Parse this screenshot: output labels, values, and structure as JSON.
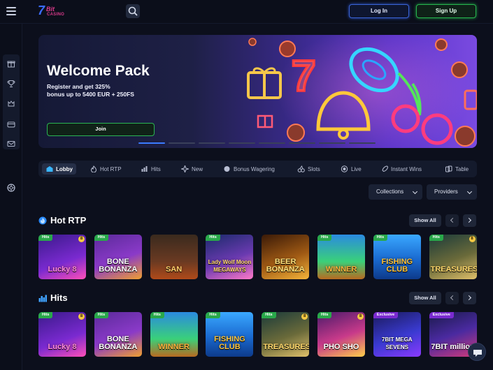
{
  "header": {
    "logo": {
      "big": "7",
      "bit": "Bit",
      "casino": "CASINO"
    },
    "login_label": "Log In",
    "signup_label": "Sign Up"
  },
  "hero": {
    "title": "Welcome Pack",
    "subtitle_line1": "Register and get 325%",
    "subtitle_line2": "bonus up to 5400 EUR + 250FS",
    "join_label": "Join",
    "slides": 8,
    "active_slide": 1
  },
  "categories": [
    {
      "label": "Lobby",
      "icon": "lobby-icon",
      "active": true
    },
    {
      "label": "Hot RTP",
      "icon": "fire-icon",
      "active": false
    },
    {
      "label": "Hits",
      "icon": "bars-icon",
      "active": false
    },
    {
      "label": "New",
      "icon": "sparkle-icon",
      "active": false
    },
    {
      "label": "Bonus Wagering",
      "icon": "coin-icon",
      "active": false
    },
    {
      "label": "Slots",
      "icon": "cherries-icon",
      "active": false
    },
    {
      "label": "Live",
      "icon": "live-icon",
      "active": false
    },
    {
      "label": "Instant Wins",
      "icon": "rocket-icon",
      "active": false
    },
    {
      "label": "Table",
      "icon": "cards-icon",
      "active": false
    }
  ],
  "filters": {
    "collections_label": "Collections",
    "providers_label": "Providers"
  },
  "sections": [
    {
      "title": "Hot RTP",
      "icon": "hot-rtp-icon",
      "show_all_label": "Show All",
      "tiles": [
        {
          "name": "Lucky 8",
          "badge": "Hits",
          "emblem": "8",
          "name_color": "#ff8ad8"
        },
        {
          "name": "BONE BONANZA",
          "badge": "Hits",
          "emblem": "",
          "name_color": "#ffffff"
        },
        {
          "name": "SAN",
          "badge": "",
          "emblem": "",
          "name_color": "#ffcf6a"
        },
        {
          "name": "Lady Wolf Moon MEGAWAYS",
          "badge": "Hits",
          "emblem": "",
          "name_color": "#ffd86b"
        },
        {
          "name": "BEER BONANZA",
          "badge": "",
          "emblem": "",
          "name_color": "#ffe07a"
        },
        {
          "name": "WINNER",
          "badge": "Hits",
          "emblem": "",
          "name_color": "#ffb03a"
        },
        {
          "name": "FISHING CLUB",
          "badge": "Hits",
          "emblem": "",
          "name_color": "#ffc53a"
        },
        {
          "name": "TREASURES",
          "badge": "Hits",
          "emblem": "8",
          "name_color": "#ffd86b"
        }
      ]
    },
    {
      "title": "Hits",
      "icon": "hits-bars-icon",
      "show_all_label": "Show All",
      "tiles": [
        {
          "name": "Lucky 8",
          "badge": "Hits",
          "emblem": "8",
          "name_color": "#ff8ad8"
        },
        {
          "name": "BONE BONANZA",
          "badge": "Hits",
          "emblem": "",
          "name_color": "#ffffff"
        },
        {
          "name": "WINNER",
          "badge": "Hits",
          "emblem": "",
          "name_color": "#ffb03a"
        },
        {
          "name": "FISHING CLUB",
          "badge": "Hits",
          "emblem": "",
          "name_color": "#ffc53a"
        },
        {
          "name": "TREASURES",
          "badge": "Hits",
          "emblem": "8",
          "name_color": "#ffd86b"
        },
        {
          "name": "PHO SHO",
          "badge": "Hits",
          "emblem": "8",
          "name_color": "#ffffff"
        },
        {
          "name": "7BIT MEGA SEVENS",
          "badge": "Exclusive",
          "emblem": "",
          "name_color": "#ffffff"
        },
        {
          "name": "7BIT million",
          "badge": "Exclusive",
          "emblem": "",
          "name_color": "#ffffff"
        }
      ]
    }
  ]
}
